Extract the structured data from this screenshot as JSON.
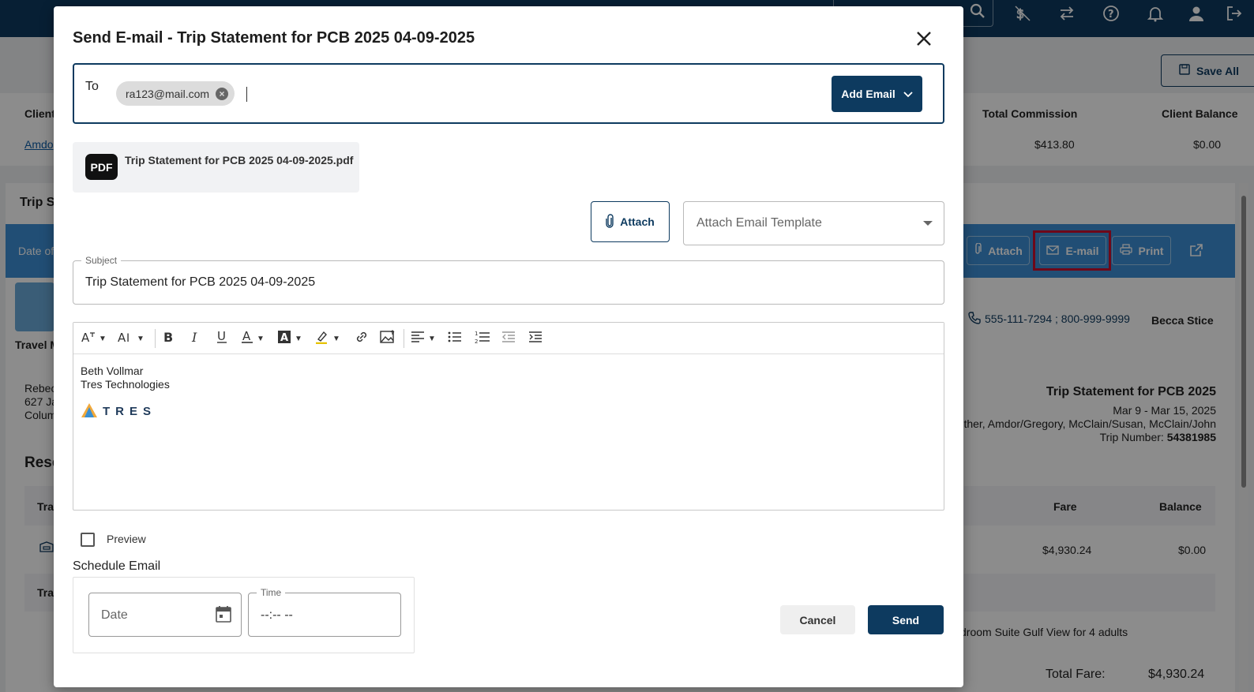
{
  "background": {
    "save_all_label": "Save All",
    "client_header": "Client",
    "client_link": "Amdo",
    "total_commission_header": "Total Commission",
    "client_balance_header": "Client Balance",
    "total_commission_value": "$413.80",
    "client_balance_value": "$0.00",
    "trip_section_title": "Trip S",
    "band_date_label": "Date of",
    "band_attach_label": "Attach",
    "band_email_label": "E-mail",
    "band_print_label": "Print",
    "travel_label": "Travel M",
    "phone_text": "555-111-7294 ; 800-999-9999",
    "agent_name": "Becca Stice",
    "address_line1": "Rebec",
    "address_line2": "627 Ja",
    "address_line3": "Colum",
    "statement_title": "Trip Statement for PCB 2025",
    "statement_dates": "Mar 9 - Mar 15, 2025",
    "statement_travelers": "ther, Amdor/Gregory, McClain/Susan, McClain/John",
    "trip_number_label": "Trip Number:",
    "trip_number_value": "54381985",
    "reservations_label": "Rese",
    "col_tra": "Tra",
    "col_fare": "Fare",
    "col_balance": "Balance",
    "row_fare": "$4,930.24",
    "row_balance": "$0.00",
    "row2_label": "Tra",
    "room_desc": "droom Suite Gulf View for 4 adults",
    "total_fare_label": "Total Fare:",
    "total_fare_value": "$4,930.24"
  },
  "modal": {
    "title": "Send E-mail - Trip Statement for PCB 2025 04-09-2025",
    "to_label": "To",
    "recipients": [
      "ra123@mail.com"
    ],
    "add_email_label": "Add Email",
    "attachment": {
      "icon_text": "PDF",
      "filename": "Trip Statement for PCB 2025 04-09-2025.pdf"
    },
    "attach_button": "Attach",
    "template_placeholder": "Attach Email Template",
    "subject_label": "Subject",
    "subject_value": "Trip Statement for PCB 2025 04-09-2025",
    "body_lines": [
      "Beth Vollmar",
      "Tres Technologies"
    ],
    "logo_text": "TRES",
    "preview_label": "Preview",
    "schedule_title": "Schedule Email",
    "date_placeholder": "Date",
    "time_label": "Time",
    "time_value": "--:-- --",
    "cancel_label": "Cancel",
    "send_label": "Send"
  },
  "colors": {
    "primary": "#0d3a5f",
    "band": "#3d8fd6",
    "highlight": "#c8102e"
  }
}
